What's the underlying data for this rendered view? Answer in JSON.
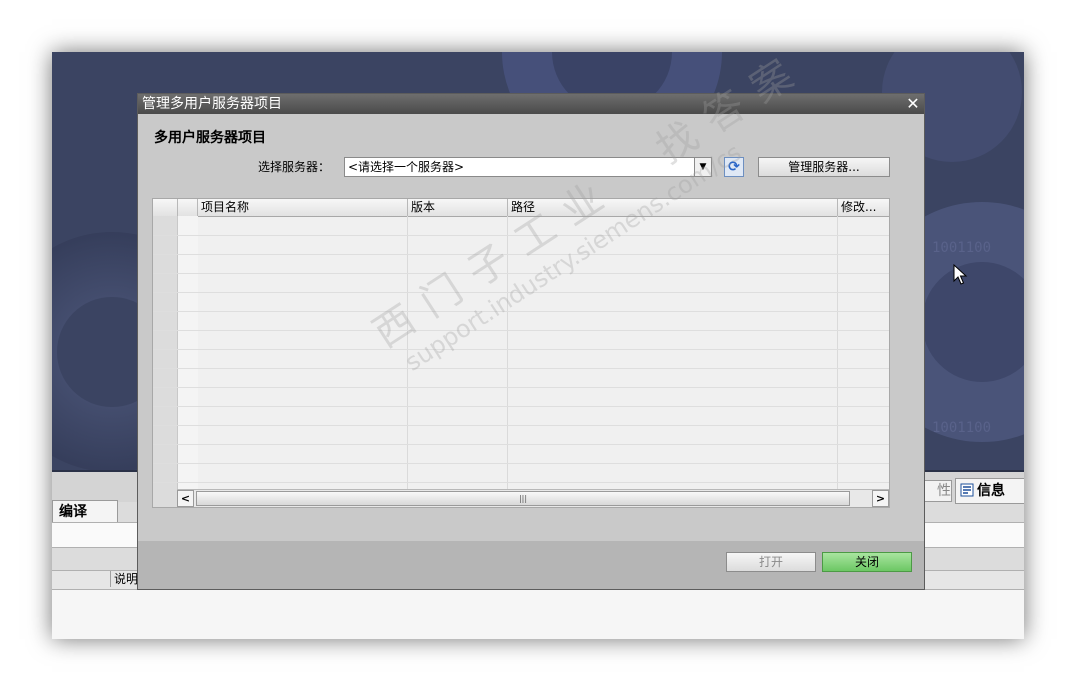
{
  "dialog": {
    "title": "管理多用户服务器项目",
    "heading": "多用户服务器项目",
    "server_label": "选择服务器：",
    "server_value": "<请选择一个服务器>",
    "manage_button": "管理服务器...",
    "open_button": "打开",
    "close_button": "关闭",
    "close_glyph": "✕",
    "refresh_glyph": "⟳",
    "columns": [
      "项目名称",
      "版本",
      "路径",
      "修改..."
    ],
    "scroll_left": "<",
    "scroll_right": ">",
    "scroll_thumb": "|||"
  },
  "bottom_panel": {
    "compile_tab": "编译",
    "info_tab": "信息",
    "partial_tab": "性",
    "desc_header": "说明"
  },
  "watermark": {
    "line1": "西门子工业",
    "line2": "找答案",
    "url": "support.industry.siemens.com/cs"
  },
  "colors": {
    "accent_green": "#6cc764",
    "refresh_blue": "#2a66c8",
    "background_navy": "#3a4361"
  }
}
